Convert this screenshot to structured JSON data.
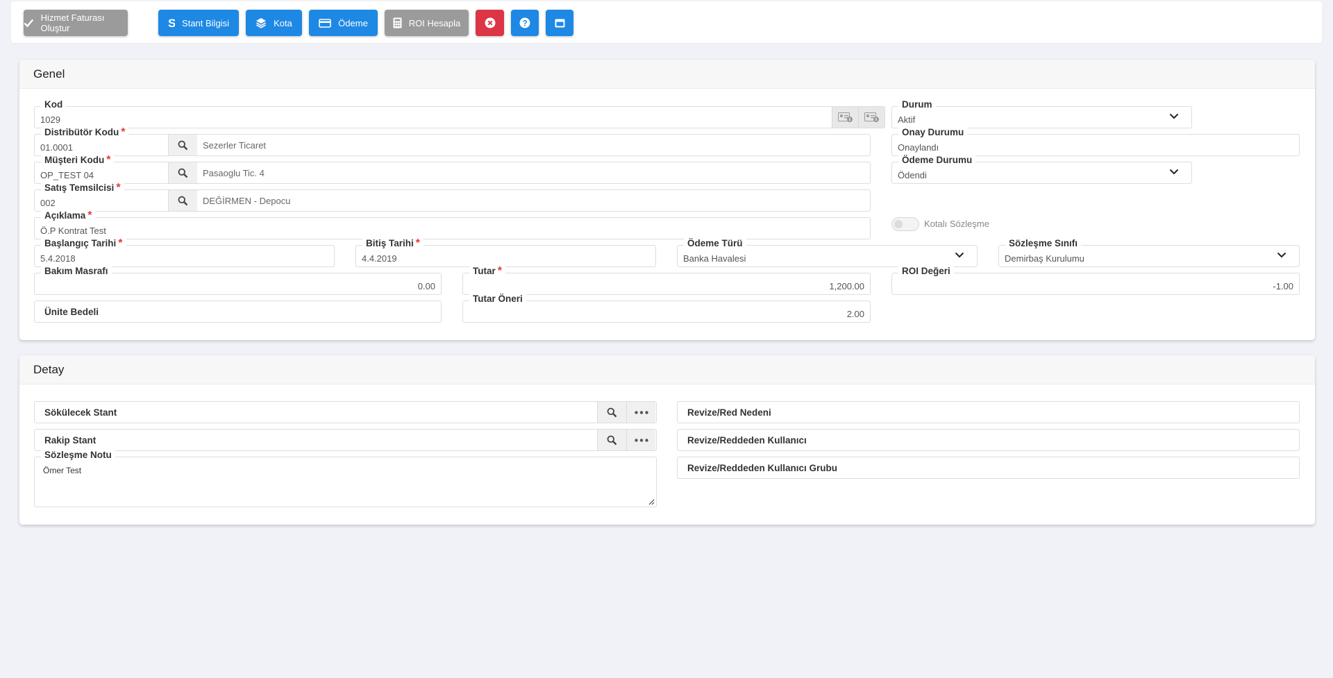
{
  "toolbar": {
    "service_invoice_label": "Hizmet Faturası Oluştur",
    "stand_info_label": "Stant Bilgisi",
    "quota_label": "Kota",
    "payment_label": "Ödeme",
    "roi_label": "ROI Hesapla"
  },
  "genel": {
    "title": "Genel",
    "kod": {
      "label": "Kod",
      "value": "1029"
    },
    "distributor": {
      "label": "Distribütör Kodu",
      "code": "01.0001",
      "name": "Sezerler Ticaret"
    },
    "musteri": {
      "label": "Müşteri Kodu",
      "code": "OP_TEST 04",
      "name": "Pasaoglu Tic. 4"
    },
    "temsilci": {
      "label": "Satış Temsilcisi",
      "code": "002",
      "name": "DEĞİRMEN - Depocu"
    },
    "aciklama": {
      "label": "Açıklama",
      "value": "Ö.P Kontrat Test"
    },
    "baslangic": {
      "label": "Başlangıç Tarihi",
      "value": "5.4.2018"
    },
    "bitis": {
      "label": "Bitiş Tarihi",
      "value": "4.4.2019"
    },
    "odeme_turu": {
      "label": "Ödeme Türü",
      "value": "Banka Havalesi"
    },
    "sozlesme_sinifi": {
      "label": "Sözleşme Sınıfı",
      "value": "Demirbaş Kurulumu"
    },
    "bakim": {
      "label": "Bakım Masrafı",
      "value": "0.00"
    },
    "tutar": {
      "label": "Tutar",
      "value": "1,200.00"
    },
    "roi": {
      "label": "ROI Değeri",
      "value": "-1.00"
    },
    "unite": {
      "label": "Ünite Bedeli"
    },
    "tutar_oneri": {
      "label": "Tutar Öneri",
      "value": "2.00"
    },
    "durum": {
      "label": "Durum",
      "value": "Aktif"
    },
    "onay": {
      "label": "Onay Durumu",
      "value": "Onaylandı"
    },
    "odeme_durumu": {
      "label": "Ödeme Durumu",
      "value": "Ödendi"
    },
    "kotali": {
      "label": "Kotalı Sözleşme",
      "on": false
    }
  },
  "detay": {
    "title": "Detay",
    "sokulecek": {
      "label": "Sökülecek Stant"
    },
    "rakip": {
      "label": "Rakip Stant"
    },
    "not": {
      "label": "Sözleşme Notu",
      "value": "Ömer Test"
    },
    "revize_neden": {
      "label": "Revize/Red Nedeni"
    },
    "revize_kullanici": {
      "label": "Revize/Reddeden Kullanıcı"
    },
    "revize_grup": {
      "label": "Revize/Reddeden Kullanıcı Grubu"
    }
  },
  "colors": {
    "primary": "#1e88e5",
    "secondary": "#9b9b9b",
    "danger": "#dc3545",
    "required": "#e53935"
  }
}
